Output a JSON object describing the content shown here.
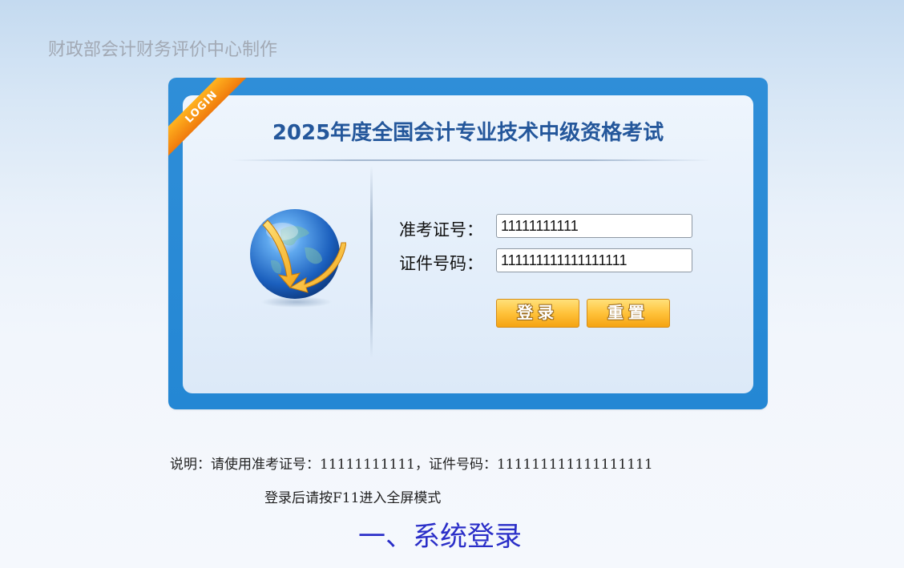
{
  "header": {
    "organization": "财政部会计财务评价中心制作"
  },
  "login_panel": {
    "ribbon_text": "LOGIN",
    "exam_title": "2025年度全国会计专业技术中级资格考试",
    "admission_label": "准考证号：",
    "admission_value": "11111111111",
    "id_label": "证件号码：",
    "id_value": "111111111111111111",
    "login_button": "登录",
    "reset_button": "重置",
    "globe_icon": "globe-icon"
  },
  "notes": {
    "instructions": "说明：请使用准考证号：11111111111，证件号码：111111111111111111",
    "fullscreen_tip": "登录后请按F11进入全屏模式"
  },
  "section": {
    "heading": "一、系统登录"
  },
  "colors": {
    "frame_blue": "#2487d4",
    "title_blue": "#24579b",
    "ribbon_orange": "#f07a0c",
    "button_gold": "#ffc23a",
    "heading_blue": "#2a2ec8"
  }
}
